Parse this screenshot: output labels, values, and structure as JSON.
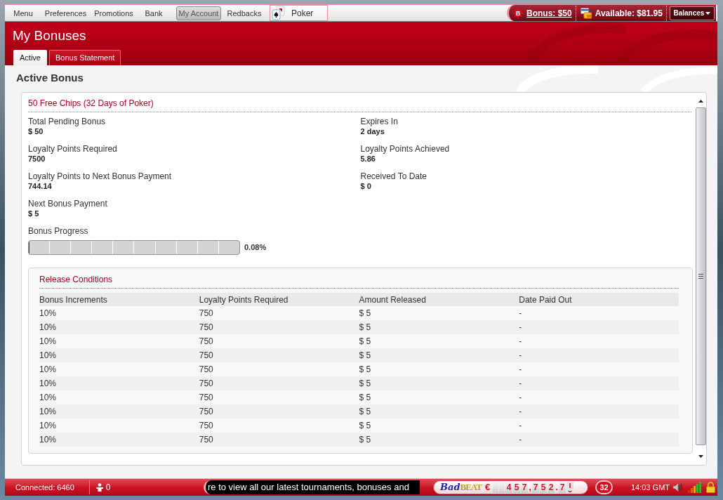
{
  "menu_bar": {
    "items": [
      {
        "label": "Menu",
        "selected": false
      },
      {
        "label": "Preferences",
        "selected": false
      },
      {
        "label": "Promotions",
        "selected": false
      },
      {
        "label": "Bank",
        "selected": false
      },
      {
        "label": "My Account",
        "selected": true
      },
      {
        "label": "Redbacks",
        "selected": false
      }
    ],
    "game_tab": {
      "label": "Poker"
    }
  },
  "balances": {
    "bonus_icon_text": "B",
    "bonus": "Bonus: $50",
    "available": "Available: $81.95",
    "button": "Balances"
  },
  "page": {
    "title": "My Bonuses",
    "tabs": [
      {
        "label": "Active",
        "selected": true
      },
      {
        "label": "Bonus Statement",
        "selected": false
      }
    ]
  },
  "section_title": "Active Bonus",
  "bonus": {
    "name": "50 Free Chips (32 Days of Poker)",
    "fields": [
      {
        "label": "Total Pending Bonus",
        "value": "$ 50"
      },
      {
        "label": "Expires In",
        "value": "2 days"
      },
      {
        "label": "Loyalty Points Required",
        "value": "7500"
      },
      {
        "label": "Loyalty Points Achieved",
        "value": "5.86"
      },
      {
        "label": "Loyalty Points to Next Bonus Payment",
        "value": "744.14"
      },
      {
        "label": "Received To Date",
        "value": "$ 0"
      },
      {
        "label": "Next Bonus Payment",
        "value": "$ 5"
      }
    ],
    "progress": {
      "label": "Bonus Progress",
      "level": 0.0008,
      "reading": "0.08%"
    }
  },
  "release_conditions": {
    "title": "Release Conditions",
    "columns": [
      "Bonus Increments",
      "Loyalty Points Required",
      "Amount Released",
      "Date Paid Out"
    ],
    "rows": [
      [
        "10%",
        "750",
        "$ 5",
        "-"
      ],
      [
        "10%",
        "750",
        "$ 5",
        "-"
      ],
      [
        "10%",
        "750",
        "$ 5",
        "-"
      ],
      [
        "10%",
        "750",
        "$ 5",
        "-"
      ],
      [
        "10%",
        "750",
        "$ 5",
        "-"
      ],
      [
        "10%",
        "750",
        "$ 5",
        "-"
      ],
      [
        "10%",
        "750",
        "$ 5",
        "-"
      ],
      [
        "10%",
        "750",
        "$ 5",
        "-"
      ],
      [
        "10%",
        "750",
        "$ 5",
        "-"
      ],
      [
        "10%",
        "750",
        "$ 5",
        "-"
      ]
    ]
  },
  "status_bar": {
    "connected": "Connected: 6460",
    "players": "0",
    "ticker": "re to view all our latest tournaments, bonuses and",
    "jackpot": {
      "logo_words": [
        {
          "text": "Bad",
          "kind": "script"
        },
        {
          "text": "BEAT",
          "kind": "block"
        }
      ],
      "currency": "€",
      "tiles": [
        {
          "kind": "blank"
        },
        {
          "kind": "blank"
        },
        {
          "kind": "digit",
          "text": "4"
        },
        {
          "kind": "digit",
          "text": "5"
        },
        {
          "kind": "digit",
          "text": "7"
        },
        {
          "kind": "separator",
          "text": ","
        },
        {
          "kind": "digit",
          "text": "7"
        },
        {
          "kind": "digit",
          "text": "5"
        },
        {
          "kind": "digit",
          "text": "2"
        },
        {
          "kind": "separator",
          "text": "."
        },
        {
          "kind": "digit",
          "text": "7"
        },
        {
          "kind": "rolling"
        }
      ]
    },
    "logo": "32",
    "time": "14:03 GMT"
  }
}
